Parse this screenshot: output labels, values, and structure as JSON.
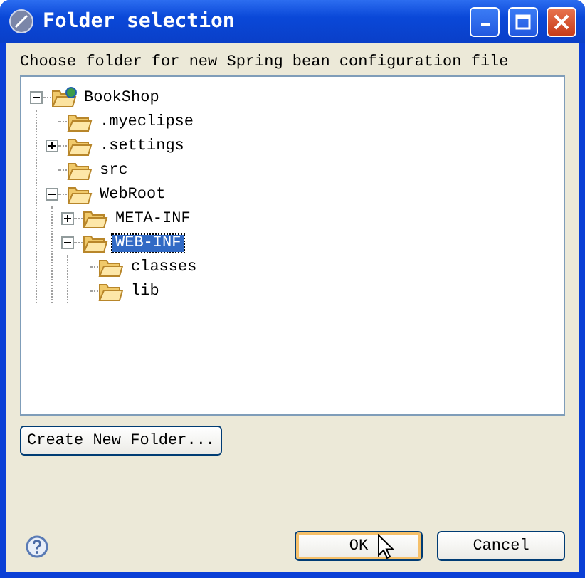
{
  "window": {
    "title": "Folder selection"
  },
  "prompt": "Choose folder for new Spring bean configuration file",
  "tree": [
    {
      "label": "BookShop",
      "kind": "project",
      "expanded": true,
      "selected": false,
      "children": [
        {
          "label": ".myeclipse",
          "kind": "folder",
          "expanded": false,
          "selected": false
        },
        {
          "label": ".settings",
          "kind": "folder",
          "expanded": false,
          "collapsible": true,
          "selected": false
        },
        {
          "label": "src",
          "kind": "folder",
          "expanded": false,
          "selected": false
        },
        {
          "label": "WebRoot",
          "kind": "folder",
          "expanded": true,
          "selected": false,
          "children": [
            {
              "label": "META-INF",
              "kind": "folder",
              "expanded": false,
              "collapsible": true,
              "selected": false
            },
            {
              "label": "WEB-INF",
              "kind": "folder",
              "expanded": true,
              "selected": true,
              "children": [
                {
                  "label": "classes",
                  "kind": "folder",
                  "expanded": false,
                  "selected": false
                },
                {
                  "label": "lib",
                  "kind": "folder",
                  "expanded": false,
                  "selected": false
                }
              ]
            }
          ]
        }
      ]
    }
  ],
  "create_button": "Create New Folder...",
  "buttons": [
    {
      "label": "OK",
      "default": true
    },
    {
      "label": "Cancel",
      "default": false
    }
  ]
}
